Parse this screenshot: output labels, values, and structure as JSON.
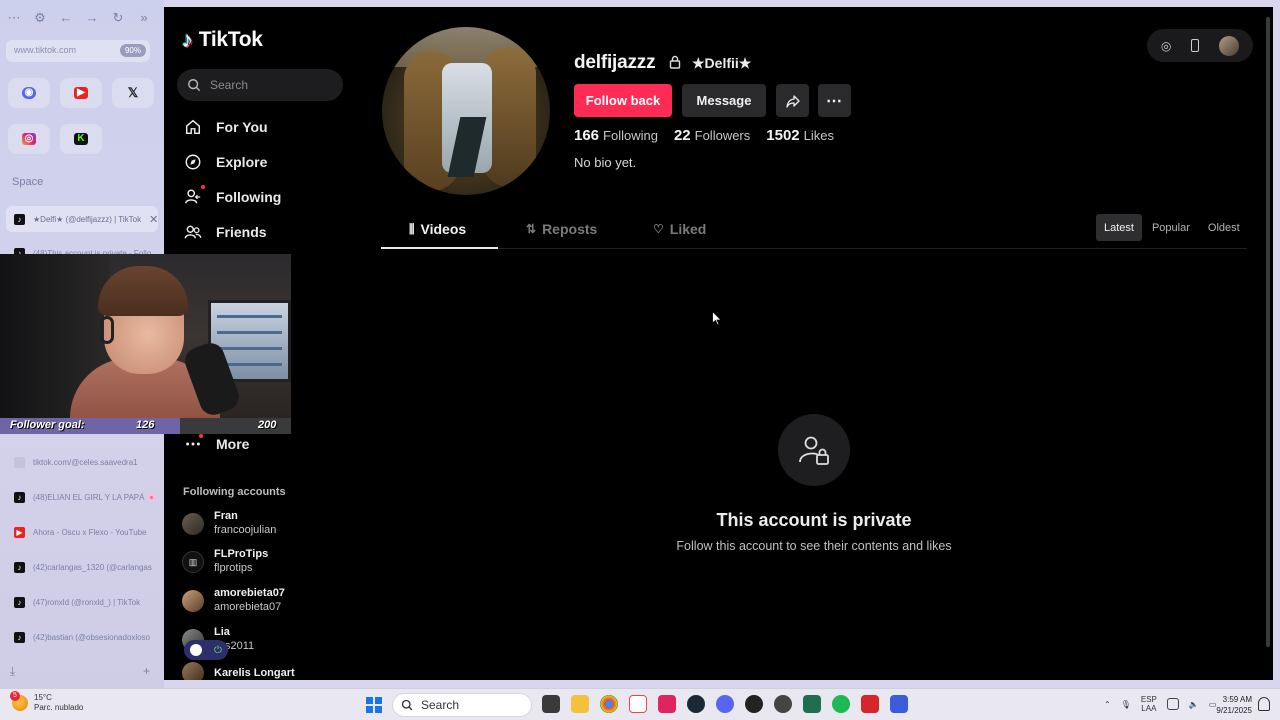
{
  "browser": {
    "url": "www.tiktok.com",
    "zoom": "90%",
    "space_label": "Space",
    "tabs": [
      {
        "title": "★Delfi★ (@delfijazzz) | TikTok",
        "icon": "tiktok"
      },
      {
        "title": "(48)This account is private - Follo",
        "icon": "tiktok"
      },
      {
        "title": "tiktok.com/@celes.saavedra1",
        "icon": "blank"
      },
      {
        "title": "(48)ELIAN EL GIRL Y LA PAPÁ 🌸",
        "icon": "tiktok"
      },
      {
        "title": "Ahora - Oscu x Flexo - YouTube",
        "icon": "youtube"
      },
      {
        "title": "(42)carlangas_1320 (@carlangas",
        "icon": "tiktok"
      },
      {
        "title": "(47)ronxld (@ronxld_) | TikTok",
        "icon": "tiktok"
      },
      {
        "title": "(42)bastian (@obsesionadoxloso",
        "icon": "tiktok"
      }
    ]
  },
  "tiktok": {
    "logo_text": "TikTok",
    "search_placeholder": "Search",
    "nav": [
      {
        "label": "For You",
        "icon": "home-icon"
      },
      {
        "label": "Explore",
        "icon": "compass-icon"
      },
      {
        "label": "Following",
        "icon": "following-icon"
      },
      {
        "label": "Friends",
        "icon": "friends-icon"
      },
      {
        "label": "More",
        "icon": "more-icon"
      }
    ],
    "following_title": "Following accounts",
    "following_accounts": [
      {
        "name": "Fran",
        "handle": "francoojulian"
      },
      {
        "name": "FLProTips",
        "handle": "flprotips"
      },
      {
        "name": "amorebieta07",
        "handle": "amorebieta07"
      },
      {
        "name": "Lia",
        "handle": "…s2011"
      },
      {
        "name": "Karelis Longart",
        "handle": ""
      }
    ],
    "profile": {
      "username": "delfijazzz",
      "nickname": "★Delfii★",
      "follow_label": "Follow back",
      "message_label": "Message",
      "following_count": "166",
      "following_label": "Following",
      "followers_count": "22",
      "followers_label": "Followers",
      "likes_count": "1502",
      "likes_label": "Likes",
      "bio": "No bio yet."
    },
    "tabs": [
      "Videos",
      "Reposts",
      "Liked"
    ],
    "sort": [
      "Latest",
      "Popular",
      "Oldest"
    ],
    "private_title": "This account is private",
    "private_sub": "Follow this account to see their contents and likes"
  },
  "stream": {
    "goal_label": "Follower goal:",
    "goal_current": "126",
    "goal_target": "200",
    "goal_fraction": 0.62
  },
  "taskbar": {
    "temp": "15°C",
    "weather": "Parc. nublado",
    "weather_badge": "5",
    "search_label": "Search",
    "lang1": "ESP",
    "lang2": "LAA",
    "time": "3:59 AM",
    "date": "9/21/2025"
  },
  "colors": {
    "accent": "#fe2c55",
    "background": "#000000",
    "taskbar": "#e9e8f1"
  }
}
